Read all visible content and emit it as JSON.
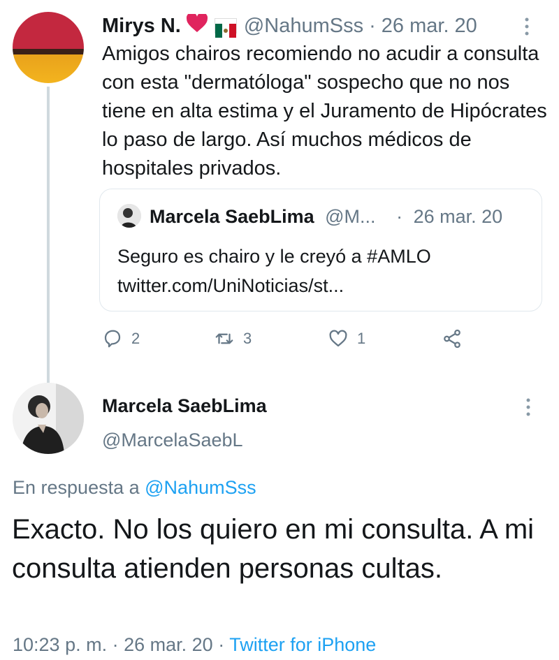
{
  "tweet1": {
    "name": "Mirys N.",
    "icons": [
      "heart-icon",
      "mexico-flag-icon"
    ],
    "handle": "@NahumSss",
    "sep": "·",
    "date": "26 mar. 20",
    "text": "Amigos chairos recomiendo no acudir a consulta con esta \"dermatóloga\" sospecho que no nos tiene en alta estima y el Juramento de Hipócrates lo paso de largo. Así muchos médicos de hospitales privados.",
    "quote": {
      "name": "Marcela SaebLima",
      "handle": "@M...",
      "sep": "·",
      "date": "26 mar. 20",
      "text_line1": "Seguro es chairo y le creyó a #AMLO",
      "text_line2": "twitter.com/UniNoticias/st..."
    },
    "actions": {
      "replies": "2",
      "retweets": "3",
      "likes": "1"
    }
  },
  "tweet2": {
    "name": "Marcela SaebLima",
    "handle": "@MarcelaSaebL",
    "reply_prefix": "En respuesta a",
    "reply_handle": "@NahumSss",
    "text": "Exacto.  No los quiero en mi consulta. A mi consulta atienden personas cultas.",
    "time": "10:23 p. m.",
    "sep1": "·",
    "date": "26 mar. 20",
    "sep2": "·",
    "source": "Twitter for iPhone"
  },
  "colors": {
    "accent": "#1da1f2",
    "muted": "#657786",
    "heart": "#e0245e"
  }
}
